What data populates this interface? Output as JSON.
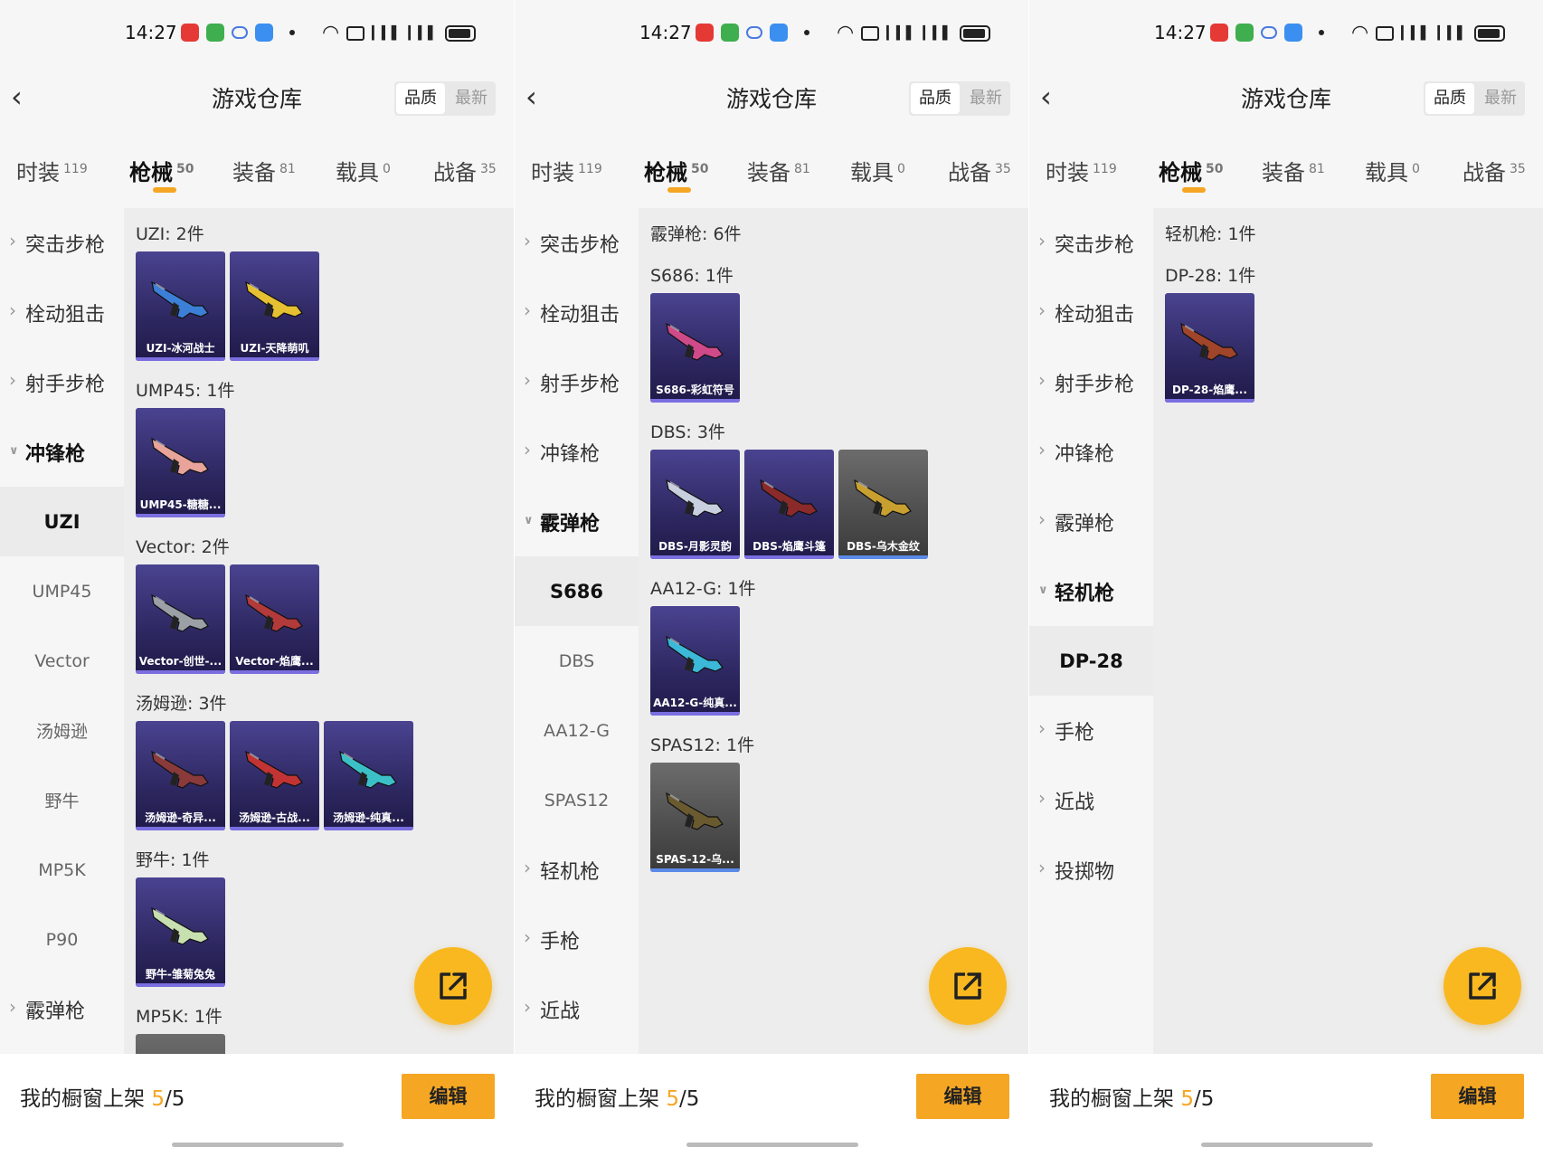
{
  "status_bar": {
    "time": "14:27"
  },
  "colors": {
    "accent": "#f5a623",
    "item_bg": "#2e2862",
    "content_bg": "#ededed"
  },
  "panels": [
    {
      "header": {
        "title": "游戏仓库",
        "sort_quality": "品质",
        "sort_newest": "最新"
      },
      "tabs": [
        {
          "label": "时装",
          "count": "119"
        },
        {
          "label": "枪械",
          "count": "50",
          "active": true
        },
        {
          "label": "装备",
          "count": "81"
        },
        {
          "label": "载具",
          "count": "0"
        },
        {
          "label": "战备",
          "count": "35"
        }
      ],
      "sidebar": [
        {
          "label": "突击步枪",
          "kind": "cat"
        },
        {
          "label": "栓动狙击",
          "kind": "cat"
        },
        {
          "label": "射手步枪",
          "kind": "cat"
        },
        {
          "label": "冲锋枪",
          "kind": "cat",
          "open": true
        },
        {
          "label": "UZI",
          "kind": "sub",
          "active": true
        },
        {
          "label": "UMP45",
          "kind": "sub"
        },
        {
          "label": "Vector",
          "kind": "sub"
        },
        {
          "label": "汤姆逊",
          "kind": "sub"
        },
        {
          "label": "野牛",
          "kind": "sub"
        },
        {
          "label": "MP5K",
          "kind": "sub"
        },
        {
          "label": "P90",
          "kind": "sub"
        },
        {
          "label": "霰弹枪",
          "kind": "cat"
        }
      ],
      "groups": [
        {
          "heading": "UZI: 2件",
          "items": [
            {
              "label": "UZI-冰河战士",
              "gun": "#3c7fd6"
            },
            {
              "label": "UZI-天降萌叽",
              "gun": "#e6c033"
            }
          ]
        },
        {
          "heading": "UMP45: 1件",
          "items": [
            {
              "label": "UMP45-糖糖...",
              "gun": "#e8a49a"
            }
          ]
        },
        {
          "heading": "Vector: 2件",
          "items": [
            {
              "label": "Vector-创世-...",
              "gun": "#9aa0a6"
            },
            {
              "label": "Vector-焰鹰...",
              "gun": "#b23a3a"
            }
          ]
        },
        {
          "heading": "汤姆逊: 3件",
          "items": [
            {
              "label": "汤姆逊-奇异...",
              "gun": "#8a3a3a"
            },
            {
              "label": "汤姆逊-古战...",
              "gun": "#c23434"
            },
            {
              "label": "汤姆逊-纯真...",
              "gun": "#3cc0c8"
            }
          ]
        },
        {
          "heading": "野牛: 1件",
          "items": [
            {
              "label": "野牛-雏菊兔兔",
              "gun": "#c8e0b0"
            }
          ]
        },
        {
          "heading": "MP5K: 1件",
          "items": [
            {
              "label": "",
              "gun": "#666666",
              "gray": true
            }
          ]
        }
      ],
      "bottom": {
        "label": "我的橱窗上架",
        "current": "5",
        "total": "/5",
        "edit": "编辑"
      }
    },
    {
      "header": {
        "title": "游戏仓库",
        "sort_quality": "品质",
        "sort_newest": "最新"
      },
      "tabs": [
        {
          "label": "时装",
          "count": "119"
        },
        {
          "label": "枪械",
          "count": "50",
          "active": true
        },
        {
          "label": "装备",
          "count": "81"
        },
        {
          "label": "载具",
          "count": "0"
        },
        {
          "label": "战备",
          "count": "35"
        }
      ],
      "sidebar": [
        {
          "label": "突击步枪",
          "kind": "cat"
        },
        {
          "label": "栓动狙击",
          "kind": "cat"
        },
        {
          "label": "射手步枪",
          "kind": "cat"
        },
        {
          "label": "冲锋枪",
          "kind": "cat"
        },
        {
          "label": "霰弹枪",
          "kind": "cat",
          "open": true
        },
        {
          "label": "S686",
          "kind": "sub",
          "active": true
        },
        {
          "label": "DBS",
          "kind": "sub"
        },
        {
          "label": "AA12-G",
          "kind": "sub"
        },
        {
          "label": "SPAS12",
          "kind": "sub"
        },
        {
          "label": "轻机枪",
          "kind": "cat"
        },
        {
          "label": "手枪",
          "kind": "cat"
        },
        {
          "label": "近战",
          "kind": "cat"
        }
      ],
      "groups": [
        {
          "heading": "霰弹枪: 6件",
          "items": []
        },
        {
          "heading": "S686: 1件",
          "items": [
            {
              "label": "S686-彩虹符号",
              "gun": "#d04a8a"
            }
          ]
        },
        {
          "heading": "DBS: 3件",
          "items": [
            {
              "label": "DBS-月影灵韵",
              "gun": "#c8d0e0"
            },
            {
              "label": "DBS-焰鹰斗篷",
              "gun": "#8a2a2a"
            },
            {
              "label": "DBS-乌木金纹",
              "gun": "#c8a030",
              "gray": true
            }
          ]
        },
        {
          "heading": "AA12-G: 1件",
          "items": [
            {
              "label": "AA12-G-纯真...",
              "gun": "#3cb8d8"
            }
          ]
        },
        {
          "heading": "SPAS12: 1件",
          "items": [
            {
              "label": "SPAS-12-乌...",
              "gun": "#6a5a30",
              "gray": true
            }
          ]
        }
      ],
      "bottom": {
        "label": "我的橱窗上架",
        "current": "5",
        "total": "/5",
        "edit": "编辑"
      }
    },
    {
      "header": {
        "title": "游戏仓库",
        "sort_quality": "品质",
        "sort_newest": "最新"
      },
      "tabs": [
        {
          "label": "时装",
          "count": "119"
        },
        {
          "label": "枪械",
          "count": "50",
          "active": true
        },
        {
          "label": "装备",
          "count": "81"
        },
        {
          "label": "载具",
          "count": "0"
        },
        {
          "label": "战备",
          "count": "35"
        }
      ],
      "sidebar": [
        {
          "label": "突击步枪",
          "kind": "cat"
        },
        {
          "label": "栓动狙击",
          "kind": "cat"
        },
        {
          "label": "射手步枪",
          "kind": "cat"
        },
        {
          "label": "冲锋枪",
          "kind": "cat"
        },
        {
          "label": "霰弹枪",
          "kind": "cat"
        },
        {
          "label": "轻机枪",
          "kind": "cat",
          "open": true
        },
        {
          "label": "DP-28",
          "kind": "sub",
          "active": true
        },
        {
          "label": "手枪",
          "kind": "cat"
        },
        {
          "label": "近战",
          "kind": "cat"
        },
        {
          "label": "投掷物",
          "kind": "cat"
        }
      ],
      "groups": [
        {
          "heading": "轻机枪: 1件",
          "items": []
        },
        {
          "heading": "DP-28: 1件",
          "items": [
            {
              "label": "DP-28-焰鹰...",
              "gun": "#a0442a"
            }
          ]
        }
      ],
      "bottom": {
        "label": "我的橱窗上架",
        "current": "5",
        "total": "/5",
        "edit": "编辑"
      }
    }
  ]
}
